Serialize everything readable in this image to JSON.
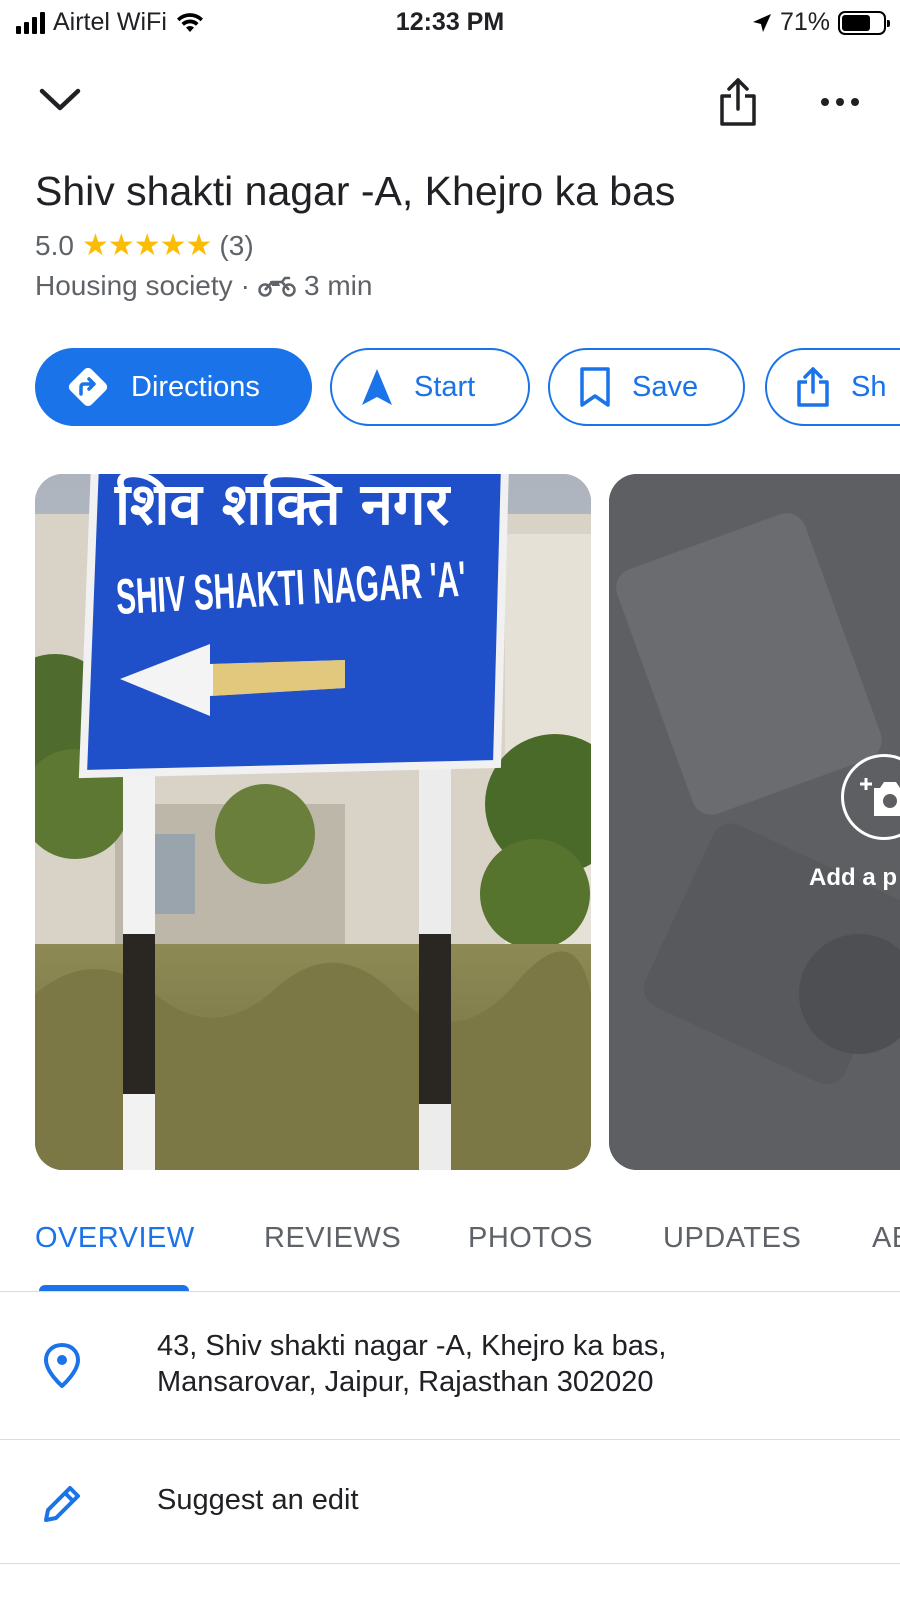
{
  "status_bar": {
    "carrier": "Airtel WiFi",
    "time": "12:33 PM",
    "battery_text": "71%",
    "battery_level": 0.71
  },
  "top_nav": {
    "collapse_icon": "chevron-down-icon",
    "share_icon": "share-icon",
    "more_icon": "more-horizontal-icon"
  },
  "place": {
    "title": "Shiv shakti nagar -A, Khejro ka bas",
    "rating": "5.0",
    "stars": 5,
    "review_count": "(3)",
    "category": "Housing society",
    "separator": "·",
    "travel_mode_icon": "motorcycle-icon",
    "travel_time": "3 min"
  },
  "actions": [
    {
      "label": "Directions",
      "icon": "directions-icon"
    },
    {
      "label": "Start",
      "icon": "navigation-arrow-icon"
    },
    {
      "label": "Save",
      "icon": "bookmark-icon"
    },
    {
      "label": "Sh",
      "icon": "share-icon"
    }
  ],
  "photos": {
    "main_sign_hindi": "शिव शक्ति नगर",
    "main_sign_english": "SHIV SHAKTI NAGAR 'A'",
    "add_photo_label": "Add a p"
  },
  "tabs": [
    {
      "label": "OVERVIEW",
      "active": true
    },
    {
      "label": "REVIEWS",
      "active": false
    },
    {
      "label": "PHOTOS",
      "active": false
    },
    {
      "label": "UPDATES",
      "active": false
    },
    {
      "label": "AB",
      "active": false
    }
  ],
  "info": {
    "address_line1": "43, Shiv shakti nagar -A, Khejro ka bas,",
    "address_line2": "Mansarovar, Jaipur, Rajasthan 302020",
    "suggest_edit": "Suggest an edit"
  },
  "colors": {
    "accent": "#1a73e8",
    "star": "#fbbc04",
    "secondary_text": "#5f6368"
  }
}
